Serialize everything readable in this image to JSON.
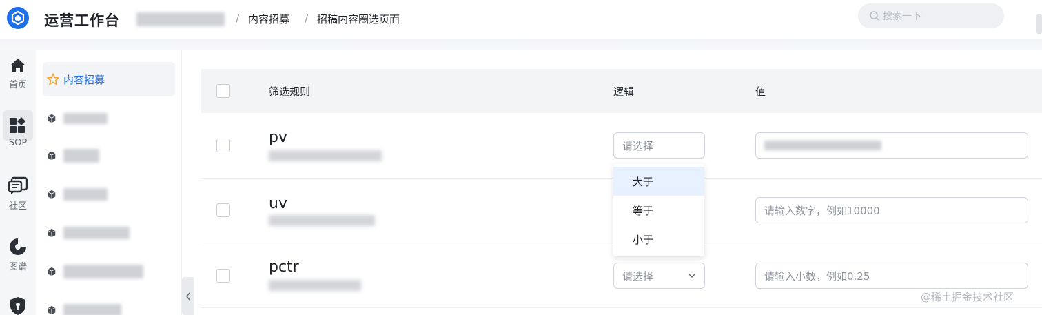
{
  "header": {
    "app_title": "运营工作台",
    "breadcrumbs": [
      "内容招募",
      "招稿内容圈选页面"
    ],
    "separator": "/",
    "search_placeholder": "搜索一下"
  },
  "rail": {
    "items": [
      {
        "label": "首页",
        "icon": "home-icon"
      },
      {
        "label": "SOP",
        "icon": "sop-widgets-icon"
      },
      {
        "label": "社区",
        "icon": "community-chat-icon"
      },
      {
        "label": "图谱",
        "icon": "graph-icon"
      },
      {
        "label": "",
        "icon": "shield-icon"
      }
    ]
  },
  "sidebar": {
    "active_item": {
      "label": "内容招募",
      "icon": "star-icon"
    },
    "items": [
      {
        "icon": "cube-icon"
      },
      {
        "icon": "cube-icon"
      },
      {
        "icon": "cube-icon"
      },
      {
        "icon": "cube-icon"
      },
      {
        "icon": "cube-icon"
      },
      {
        "icon": "cube-icon"
      }
    ]
  },
  "table": {
    "columns": [
      "筛选规则",
      "逻辑",
      "值"
    ],
    "rows": [
      {
        "rule": "pv",
        "logic_placeholder": "请选择",
        "value_placeholder": ""
      },
      {
        "rule": "uv",
        "logic_placeholder": "",
        "value_placeholder": "请输入数字，例如10000"
      },
      {
        "rule": "pctr",
        "logic_placeholder": "请选择",
        "value_placeholder": "请输入小数，例如0.25"
      }
    ]
  },
  "dropdown": {
    "options": [
      "大于",
      "等于",
      "小于"
    ],
    "highlighted": "大于"
  },
  "watermark": "@稀土掘金技术社区",
  "colors": {
    "accent": "#1f6feb",
    "highlight": "#e8f1ff"
  }
}
